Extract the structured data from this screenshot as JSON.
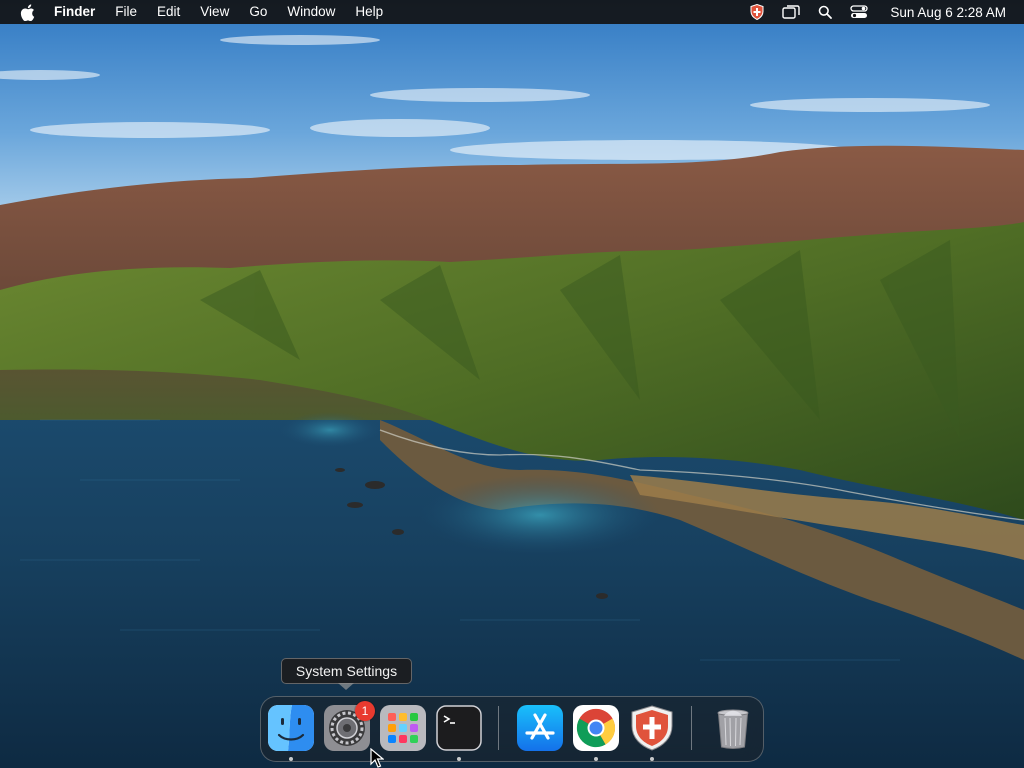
{
  "menubar": {
    "app_name": "Finder",
    "menus": [
      "File",
      "Edit",
      "View",
      "Go",
      "Window",
      "Help"
    ],
    "clock": "Sun Aug 6  2:28 AM",
    "status_icons": [
      "shield-icon",
      "screen-mirroring-icon",
      "search-icon",
      "control-center-icon"
    ]
  },
  "dock": {
    "tooltip": "System Settings",
    "apps": [
      {
        "name": "Finder",
        "icon": "finder-icon",
        "running": true
      },
      {
        "name": "System Settings",
        "icon": "gear-icon",
        "running": false,
        "badge": "1"
      },
      {
        "name": "Launchpad",
        "icon": "launchpad-icon",
        "running": false
      },
      {
        "name": "Terminal",
        "icon": "terminal-icon",
        "running": true
      },
      {
        "name": "App Store",
        "icon": "app-store-icon",
        "running": false
      },
      {
        "name": "Google Chrome",
        "icon": "chrome-icon",
        "running": true
      },
      {
        "name": "Shield App",
        "icon": "shield-app-icon",
        "running": true
      },
      {
        "name": "Trash",
        "icon": "trash-icon",
        "running": false
      }
    ]
  },
  "colors": {
    "menubar_bg": "#121214",
    "badge": "#e83a2f",
    "sea": "#163a55",
    "sky": "#4d8fcf"
  }
}
